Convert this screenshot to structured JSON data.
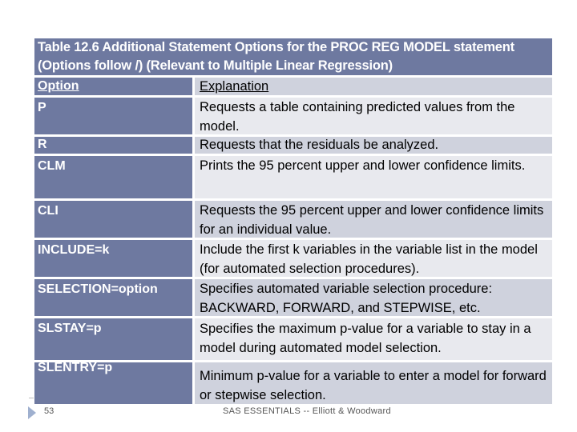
{
  "table": {
    "title": "Table 12.6 Additional Statement Options for the PROC REG MODEL statement (Options follow /) (Relevant to Multiple Linear Regression)",
    "headers": {
      "option": "Option",
      "explanation": "Explanation"
    },
    "rows": [
      {
        "option": "P",
        "explanation": "Requests a table containing predicted values from the model."
      },
      {
        "option": "R",
        "explanation": "Requests that the residuals be analyzed."
      },
      {
        "option": "CLM",
        "explanation": "Prints the 95 percent upper and lower confidence limits."
      },
      {
        "option": "CLI",
        "explanation": "Requests the 95 percent upper and lower confidence limits for an individual value."
      },
      {
        "option": "INCLUDE=k",
        "explanation": "Include the first k variables in the variable list in the model (for automated selection procedures)."
      },
      {
        "option": "SELECTION=option",
        "explanation": "Specifies automated variable selection procedure: BACKWARD, FORWARD, and STEPWISE, etc."
      },
      {
        "option": "SLSTAY=p",
        "explanation": "Specifies the maximum p-value for a variable to stay in a model during automated model selection."
      },
      {
        "option": "SLENTRY=p",
        "explanation": "Minimum p-value for a variable to enter a model for forward or stepwise selection."
      }
    ]
  },
  "footer": {
    "page": "53",
    "text": "SAS ESSENTIALS -- Elliott & Woodward"
  }
}
